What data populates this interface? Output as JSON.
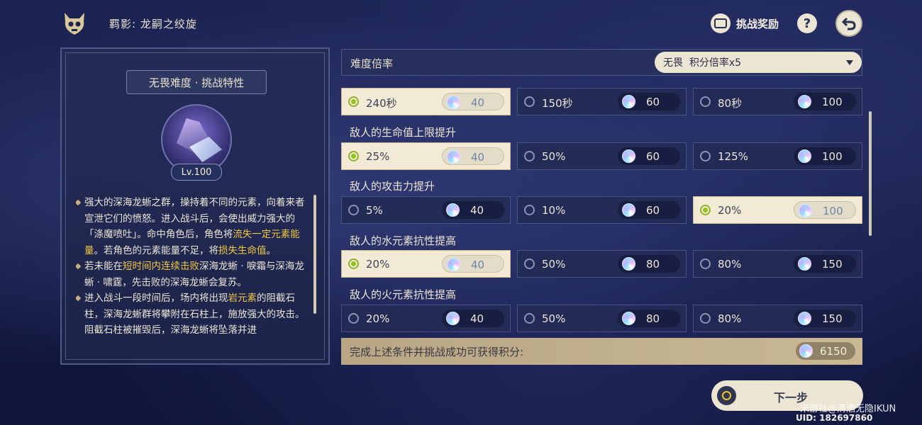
{
  "header": {
    "title": "羁影: 龙嗣之绞旋",
    "reward_label": "挑战奖励",
    "help_label": "?",
    "icons": {
      "skull": "skull-icon",
      "reward": "gift-icon",
      "help": "help-icon",
      "back": "back-arrow-icon"
    }
  },
  "left_panel": {
    "title": "无畏难度 · 挑战特性",
    "level": "Lv.100",
    "desc": [
      [
        {
          "t": "强大的深海龙蜥之群，操持着不同的元素，向着来者宣泄它们的愤怒。进入战斗后，会使出威力强大的「涤魔喷吐」。命中角色后，角色将"
        },
        {
          "t": "流失一定元素能量",
          "hl": true
        },
        {
          "t": "。若角色的元素能量不足，将"
        },
        {
          "t": "损失生命值",
          "hl": true
        },
        {
          "t": "。"
        }
      ],
      [
        {
          "t": "若未能在"
        },
        {
          "t": "短时间内连续击败",
          "hl": true
        },
        {
          "t": "深海龙蜥 · 唳霜与深海龙蜥 · 啸霆，先击败的深海龙蜥会复苏。"
        }
      ],
      [
        {
          "t": "进入战斗一段时间后，场内将出现"
        },
        {
          "t": "岩元素",
          "hl": true
        },
        {
          "t": "的阻截石柱，深海龙蜥群将攀附在石柱上，施放强大的攻击。阻截石柱被摧毁后，深海龙蜥将坠落并进"
        }
      ]
    ]
  },
  "difficulty": {
    "label": "难度倍率",
    "selected": "无畏  积分倍率x5"
  },
  "rows": [
    {
      "label": "",
      "options": [
        {
          "label": "240秒",
          "points": "40",
          "selected": true
        },
        {
          "label": "150秒",
          "points": "60",
          "selected": false
        },
        {
          "label": "80秒",
          "points": "100",
          "selected": false
        }
      ]
    },
    {
      "label": "敌人的生命值上限提升",
      "options": [
        {
          "label": "25%",
          "points": "40",
          "selected": true
        },
        {
          "label": "50%",
          "points": "60",
          "selected": false
        },
        {
          "label": "125%",
          "points": "100",
          "selected": false
        }
      ]
    },
    {
      "label": "敌人的攻击力提升",
      "options": [
        {
          "label": "5%",
          "points": "40",
          "selected": false
        },
        {
          "label": "10%",
          "points": "60",
          "selected": false
        },
        {
          "label": "20%",
          "points": "100",
          "selected": true
        }
      ]
    },
    {
      "label": "敌人的水元素抗性提高",
      "options": [
        {
          "label": "20%",
          "points": "40",
          "selected": true
        },
        {
          "label": "50%",
          "points": "80",
          "selected": false
        },
        {
          "label": "80%",
          "points": "150",
          "selected": false
        }
      ]
    },
    {
      "label": "敌人的火元素抗性提高",
      "options": [
        {
          "label": "20%",
          "points": "40",
          "selected": false
        },
        {
          "label": "50%",
          "points": "80",
          "selected": false
        },
        {
          "label": "80%",
          "points": "150",
          "selected": false
        }
      ]
    }
  ],
  "total": {
    "label": "完成上述条件并挑战成功可获得积分:",
    "points": "6150"
  },
  "next_button": {
    "label": "下一步"
  },
  "watermark": "米游社@清酒无隐IKUN",
  "uid": "UID: 182697860",
  "colors": {
    "selected_bg": "#f3ead6",
    "highlight_text": "#f3c845",
    "radio_selected": "#93c21f",
    "total_bar": "#c9b893"
  }
}
